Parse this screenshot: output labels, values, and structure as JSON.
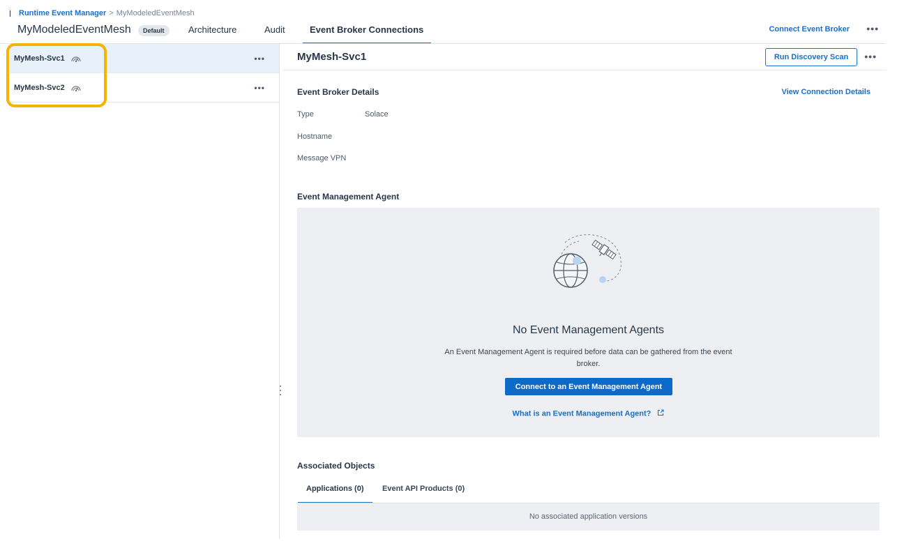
{
  "breadcrumb": {
    "items": [
      "Runtime Event Manager",
      "MyModeledEventMesh"
    ],
    "separator": ">"
  },
  "header": {
    "title": "MyModeledEventMesh",
    "badge": "Default",
    "tabs": [
      {
        "label": "Architecture",
        "active": false
      },
      {
        "label": "Audit",
        "active": false
      },
      {
        "label": "Event Broker Connections",
        "active": true
      }
    ],
    "connect_broker_label": "Connect Event Broker",
    "more_label": "•••"
  },
  "services": [
    {
      "name": "MyMesh-Svc1",
      "selected": true,
      "icon": "broker-gauge-icon"
    },
    {
      "name": "MyMesh-Svc2",
      "selected": false,
      "icon": "broker-gauge-icon"
    }
  ],
  "detail": {
    "title": "MyMesh-Svc1",
    "scan_button": "Run Discovery Scan",
    "broker_details": {
      "heading": "Event Broker Details",
      "view_link": "View Connection Details",
      "fields": [
        {
          "label": "Type",
          "value": "Solace"
        },
        {
          "label": "Hostname",
          "value": ""
        },
        {
          "label": "Message VPN",
          "value": ""
        }
      ]
    },
    "agent": {
      "heading": "Event Management Agent",
      "empty_title": "No Event Management Agents",
      "empty_desc": "An Event Management Agent is required before data can be gathered from the event broker.",
      "connect_button": "Connect to an Event Management Agent",
      "help_link": "What is an Event Management Agent?",
      "illustration": "globe-satellite-icon"
    },
    "associated": {
      "heading": "Associated Objects",
      "tabs": [
        {
          "label": "Applications (0)",
          "active": true
        },
        {
          "label": "Event API Products (0)",
          "active": false
        }
      ],
      "empty_text": "No associated application versions"
    }
  },
  "colors": {
    "accent": "#1a6fc9",
    "primary_button": "#0e6ac9",
    "highlight": "#f5b400",
    "selected_row": "#e8f0f9",
    "empty_panel": "#edeff2"
  }
}
